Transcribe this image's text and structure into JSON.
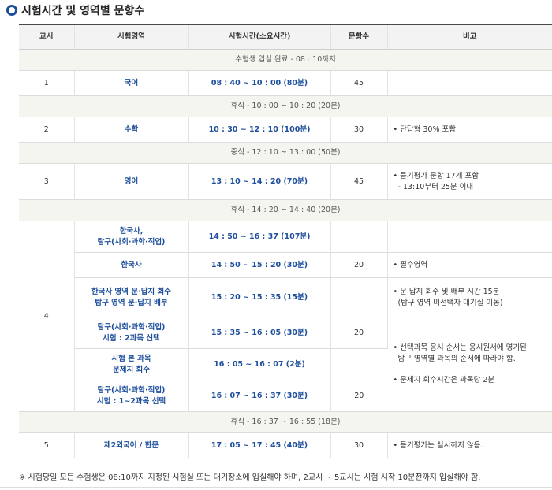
{
  "page": {
    "title": "시험시간 및 영역별 문항수",
    "footer": "※ 시험당일 모든 수험생은 08:10까지 지정된 시험실 또는 대기장소에 입실해야 하며, 2교시 ~ 5교시는 시험 시작 10분전까지 입실해야 함."
  },
  "headers": {
    "period": "교시",
    "area": "시험영역",
    "time": "시험시간(소요시간)",
    "count": "문항수",
    "note": "비고"
  },
  "breaks": {
    "entry": "수험생 입실 완료 - 08 : 10까지",
    "b1": "휴식 - 10 : 00 ~ 10 : 20 (20분)",
    "lunch": "중식 - 12 : 10 ~ 13 : 00 (50분)",
    "b2": "휴식 - 14 : 20 ~ 14 : 40 (20분)",
    "b3": "휴식 - 16 : 37 ~ 16 : 55 (18분)"
  },
  "rows": {
    "r1": {
      "period": "1",
      "area": "국어",
      "time": "08 : 40 ~ 10 : 00 (80분)",
      "count": "45",
      "note": ""
    },
    "r2": {
      "period": "2",
      "area": "수학",
      "time": "10 : 30 ~ 12 : 10 (100분)",
      "count": "30",
      "note": "• 단답형 30% 포함"
    },
    "r3": {
      "period": "3",
      "area": "영어",
      "time": "13 : 10 ~ 14 : 20 (70분)",
      "count": "45",
      "note1": "• 듣기평가 문항 17개 포함",
      "note2": "- 13:10부터 25분 이내"
    },
    "r4": {
      "period": "4",
      "a_area1": "한국사,",
      "a_area2": "탐구(사회·과학·직업)",
      "a_time": "14 : 50 ~ 16 : 37 (107분)",
      "b_area": "한국사",
      "b_time": "14 : 50 ~ 15 : 20 (30분)",
      "b_count": "20",
      "b_note": "• 필수영역",
      "c_area1": "한국사 영역 문·답지 회수",
      "c_area2": "탐구 영역 문·답지 배부",
      "c_time": "15 : 20 ~ 15 : 35 (15분)",
      "c_note1": "• 문·답지 회수 및 배부 시간 15분",
      "c_note2": "(탐구 영역 미선택자 대기실 이동)",
      "d_area1": "탐구(사회·과학·직업)",
      "d_area2": "시험 : 2과목 선택",
      "d_time": "15 : 35 ~ 16 : 05 (30분)",
      "d_count": "20",
      "d_note1": "• 선택과목 응시 순서는 응시원서에 명기된",
      "d_note2": "탐구 영역별 과목의 순서에 따라야 함.",
      "d_note3": "• 문제지 회수시간은 과목당 2분",
      "e_area1": "시험 본 과목",
      "e_area2": "문제지 회수",
      "e_time": "16 : 05 ~ 16 : 07 (2분)",
      "f_area1": "탐구(사회·과학·직업)",
      "f_area2": "시험 : 1~2과목 선택",
      "f_time": "16 : 07 ~ 16 : 37 (30분)",
      "f_count": "20"
    },
    "r5": {
      "period": "5",
      "area": "제2외국어 / 한문",
      "time": "17 : 05 ~ 17 : 45 (40분)",
      "count": "30",
      "note": "• 듣기평가는 실시하지 않음."
    }
  }
}
